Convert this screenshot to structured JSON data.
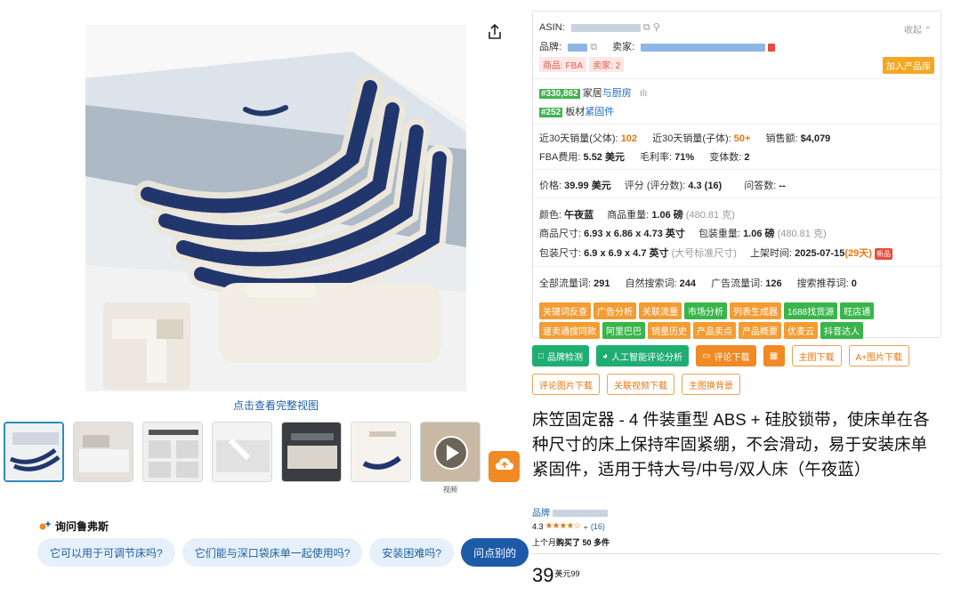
{
  "gallery": {
    "view_full_label": "点击查看完整视图",
    "video_label": "视频"
  },
  "ask": {
    "title": "询问鲁弗斯",
    "chips": [
      "它可以用于可调节床吗?",
      "它们能与深口袋床单一起使用吗?",
      "安装困难吗?",
      "问点别的"
    ]
  },
  "panel": {
    "asin_label": "ASIN:",
    "collapse_label": "收起",
    "brand_label": "品牌:",
    "seller_label": "卖家:",
    "tag_goods": "商品: FBA",
    "tag_sellers": "卖家: 2",
    "add_library": "加入产品库",
    "rank1_badge": "#330,862",
    "rank1_cat_a": "家居",
    "rank1_cat_b": "与厨房",
    "rank2_badge": "#252",
    "rank2_cat_a": "板材",
    "rank2_cat_b": "紧固件",
    "sales_parent_label": "近30天销量(父体):",
    "sales_parent": "102",
    "sales_child_label": "近30天销量(子体):",
    "sales_child": "50+",
    "revenue_label": "销售额:",
    "revenue": "$4,079",
    "fba_label": "FBA费用:",
    "fba": "5.52 美元",
    "margin_label": "毛利率:",
    "margin": "71%",
    "variants_label": "变体数:",
    "variants": "2",
    "price_label": "价格:",
    "price": "39.99 美元",
    "rating_label": "评分 (评分数):",
    "rating": "4.3",
    "rating_count": "(16)",
    "qa_label": "问答数:",
    "qa": "--",
    "color_label": "颜色:",
    "color": "午夜蓝",
    "weight_label": "商品重量:",
    "weight": "1.06 磅",
    "weight_g": "(480.81 克)",
    "dims_label": "商品尺寸:",
    "dims": "6.93 x 6.86 x 4.73 英寸",
    "pkg_weight_label": "包装重量:",
    "pkg_weight": "1.06 磅",
    "pkg_weight_g": "(480.81 克)",
    "pkg_dims_label": "包装尺寸:",
    "pkg_dims": "6.9 x 6.9 x 4.7 英寸",
    "pkg_size_class": "(大号标准尺寸)",
    "listed_label": "上架时间:",
    "listed": "2025-07-15",
    "listed_days": "(29天)",
    "new_badge": "新品",
    "kw_all_label": "全部流量词:",
    "kw_all": "291",
    "kw_organic_label": "自然搜索词:",
    "kw_organic": "244",
    "kw_ads_label": "广告流量词:",
    "kw_ads": "126",
    "kw_rec_label": "搜索推荐词:",
    "kw_rec": "0",
    "tags": [
      {
        "text": "关键词反查",
        "color": "o"
      },
      {
        "text": "广告分析",
        "color": "o"
      },
      {
        "text": "关联流量",
        "color": "o"
      },
      {
        "text": "市场分析",
        "color": "g"
      },
      {
        "text": "列表生成器",
        "color": "o"
      },
      {
        "text": "1688找货源",
        "color": "g"
      },
      {
        "text": "旺店通",
        "color": "g"
      },
      {
        "text": "速卖通搜同款",
        "color": "o"
      },
      {
        "text": "阿里巴巴",
        "color": "g"
      },
      {
        "text": "销量历史",
        "color": "o"
      },
      {
        "text": "产品卖点",
        "color": "o"
      },
      {
        "text": "产品概要",
        "color": "o"
      },
      {
        "text": "优麦云",
        "color": "o"
      },
      {
        "text": "抖音达人",
        "color": "g"
      }
    ]
  },
  "toolbar": {
    "brand_check": "品牌检测",
    "ai_review": "人工智能评论分析",
    "review_download": "评论下载",
    "main_img_download": "主图下载",
    "aplus_download": "A+图片下载",
    "review_img_download": "评论图片下载",
    "video_download": "关联视频下载",
    "main_img_swap": "主图换背景"
  },
  "product": {
    "title": "床笠固定器 - 4 件装重型 ABS + 硅胶锁带，使床单在各种尺寸的床上保持牢固紧绷，不会滑动，易于安装床单紧固件，适用于特大号/中号/双人床（午夜蓝）",
    "brand_prefix": "品牌",
    "rating": "4.3",
    "stars": "★★★★☆",
    "rating_count": "(16)",
    "bought_prefix": "上个月",
    "bought": "购买了 50 多件",
    "price_whole": "39",
    "price_sup": "美元99"
  },
  "colors": {
    "accent_orange": "#f08a24",
    "accent_green": "#1fae72",
    "link_blue": "#2162a1",
    "navy": "#1f3a7a"
  }
}
